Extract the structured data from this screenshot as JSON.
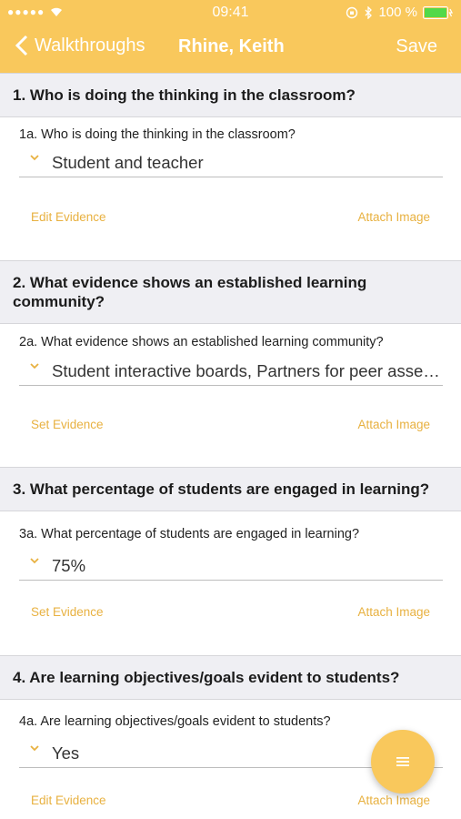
{
  "status_bar": {
    "signal": "●●●●●",
    "time": "09:41",
    "battery": "100 %"
  },
  "nav": {
    "back_label": "Walkthroughs",
    "title": "Rhine, Keith",
    "save_label": "Save"
  },
  "questions": [
    {
      "title": "1. Who is doing the thinking in the classroom?",
      "sub": "1a. Who is doing the thinking in the classroom?",
      "value": "Student and teacher",
      "evidence_label": "Edit Evidence",
      "image_label": "Attach Image"
    },
    {
      "title": "2. What evidence shows an established learning community?",
      "sub": "2a. What evidence shows an established learning community?",
      "value": "Student interactive boards, Partners for peer assessm...",
      "evidence_label": "Set Evidence",
      "image_label": "Attach Image"
    },
    {
      "title": "3. What percentage of students are engaged in learning?",
      "sub": "3a. What percentage of students are engaged in learning?",
      "value": "75%",
      "evidence_label": "Set Evidence",
      "image_label": "Attach Image"
    },
    {
      "title": "4. Are learning objectives/goals evident to students?",
      "sub": "4a. Are learning objectives/goals evident to students?",
      "value": "Yes",
      "evidence_label": "Edit Evidence",
      "image_label": "Attach Image"
    }
  ],
  "colors": {
    "accent": "#f9c85c",
    "link": "#e8b140",
    "section_bg": "#efeff3"
  },
  "icons": {
    "back": "chevron-left-icon",
    "dropdown": "chevron-down-icon",
    "fab": "menu-icon"
  }
}
